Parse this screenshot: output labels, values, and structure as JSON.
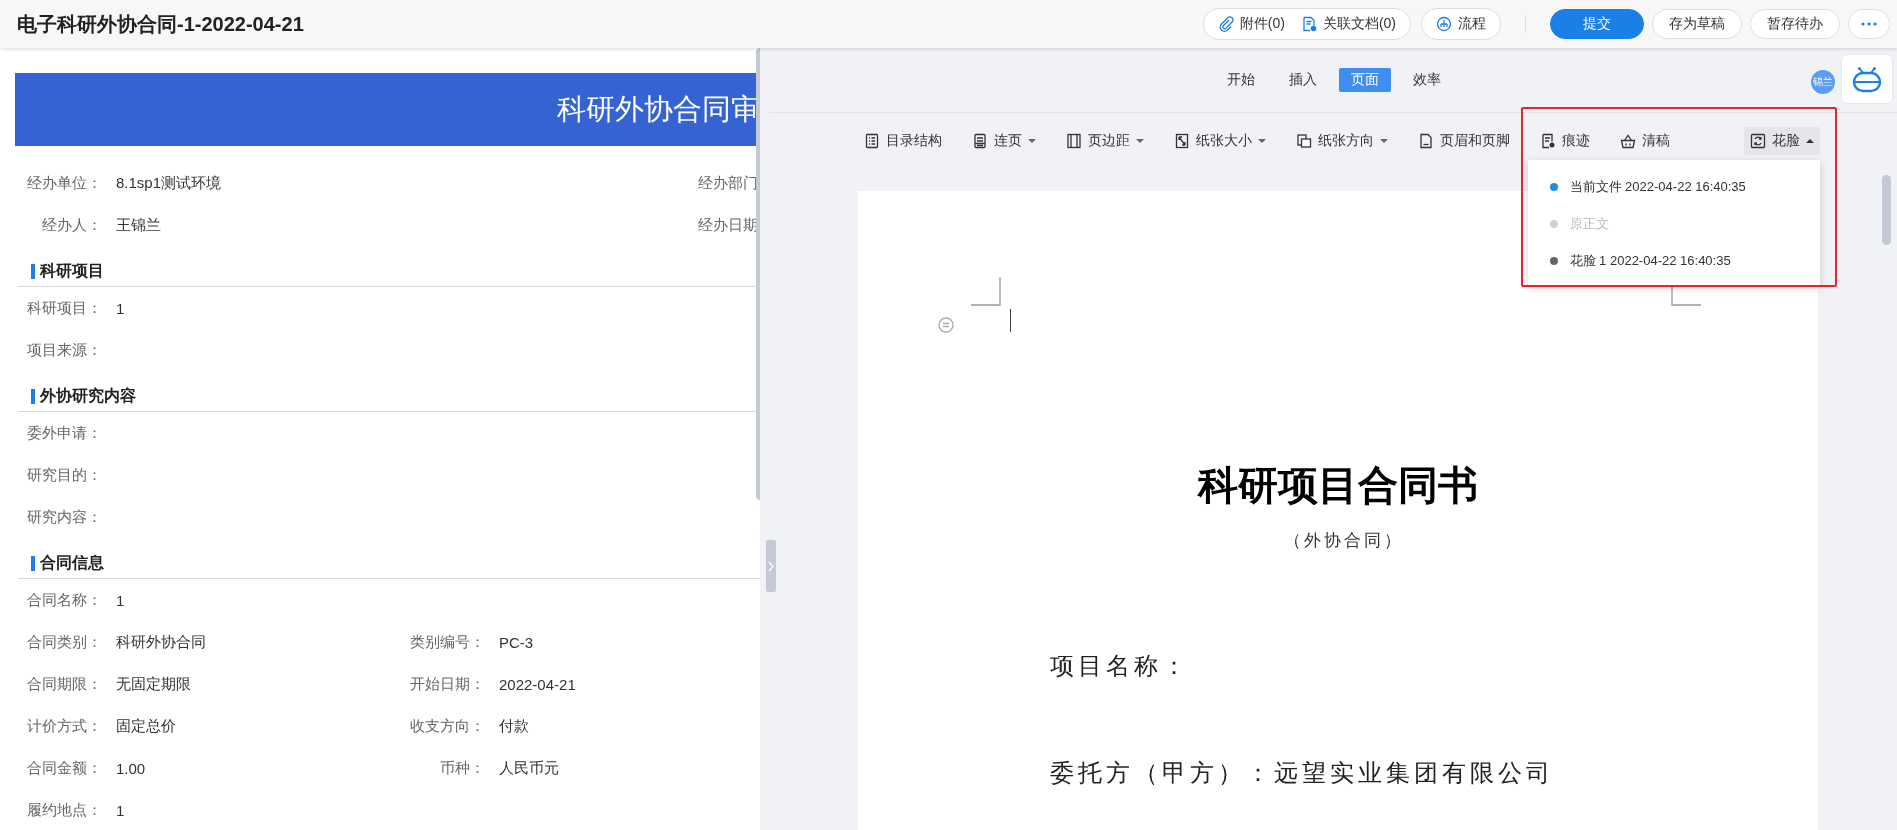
{
  "header": {
    "title": "电子科研外协合同-1-2022-04-21",
    "links": [
      {
        "label": "附件(0)",
        "kind": "attach"
      },
      {
        "label": "关联文档(0)",
        "kind": "linked"
      }
    ],
    "flow_button": "流程",
    "buttons": [
      {
        "label": "提交",
        "primary": true
      },
      {
        "label": "存为草稿",
        "primary": false
      },
      {
        "label": "暂存待办",
        "primary": false
      }
    ]
  },
  "form": {
    "banner": "科研外协合同审",
    "top_rows": [
      {
        "label": "经办单位：",
        "value": "8.1sp1测试环境",
        "right_label": "经办部门"
      },
      {
        "label": "经办人：",
        "value": "王锦兰",
        "right_label": "经办日期"
      }
    ],
    "sections": [
      {
        "title": "科研项目",
        "rows": [
          [
            {
              "label": "科研项目：",
              "value": "1"
            }
          ],
          [
            {
              "label": "项目来源："
            }
          ]
        ]
      },
      {
        "title": "外协研究内容",
        "rows": [
          [
            {
              "label": "委外申请："
            }
          ],
          [
            {
              "label": "研究目的："
            }
          ],
          [
            {
              "label": "研究内容："
            }
          ]
        ]
      },
      {
        "title": "合同信息",
        "rows": [
          [
            {
              "label": "合同名称：",
              "value": "1"
            }
          ],
          [
            {
              "label": "合同类别：",
              "value": "科研外协合同"
            },
            {
              "label": "类别编号：",
              "value": "PC-3"
            }
          ],
          [
            {
              "label": "合同期限：",
              "value": "无固定期限"
            },
            {
              "label": "开始日期：",
              "value": "2022-04-21"
            }
          ],
          [
            {
              "label": "计价方式：",
              "value": "固定总价"
            },
            {
              "label": "收支方向：",
              "value": "付款"
            }
          ],
          [
            {
              "label": "合同金额：",
              "value": "1.00"
            },
            {
              "label": "币种：",
              "value": "人民币元"
            }
          ],
          [
            {
              "label": "履约地点：",
              "value": "1"
            }
          ]
        ]
      }
    ]
  },
  "editor": {
    "tabs": [
      {
        "label": "开始",
        "selected": false
      },
      {
        "label": "插入",
        "selected": false
      },
      {
        "label": "页面",
        "selected": true
      },
      {
        "label": "效率",
        "selected": false
      }
    ],
    "avatar": "锦兰",
    "toolbar": [
      {
        "label": "目录结构",
        "kind": "toc",
        "dropdown": false,
        "expanded": false
      },
      {
        "label": "连页",
        "kind": "page",
        "dropdown": true,
        "expanded": false
      },
      {
        "label": "页边距",
        "kind": "margin",
        "dropdown": true,
        "expanded": false
      },
      {
        "label": "纸张大小",
        "kind": "size",
        "dropdown": true,
        "expanded": false
      },
      {
        "label": "纸张方向",
        "kind": "orient",
        "dropdown": true,
        "expanded": false
      },
      {
        "label": "页眉和页脚",
        "kind": "header",
        "dropdown": false,
        "expanded": false
      },
      {
        "label": "痕迹",
        "kind": "trace",
        "dropdown": false,
        "expanded": false
      },
      {
        "label": "清稿",
        "kind": "clean",
        "dropdown": false,
        "expanded": false
      },
      {
        "label": "花脸",
        "kind": "face",
        "dropdown": true,
        "expanded": true
      }
    ],
    "menu": [
      {
        "label": "当前文件 2022-04-22 16:40:35",
        "color": "#1a8fe3",
        "disabled": false
      },
      {
        "label": "原正文",
        "color": "#d0d0d0",
        "disabled": true
      },
      {
        "label": "花脸 1 2022-04-22 16:40:35",
        "color": "#666666",
        "disabled": false
      }
    ],
    "document": {
      "title": "科研项目合同书",
      "subtitle": "（外协合同）",
      "lines": [
        "项目名称：",
        "委托方（甲方）：远望实业集团有限公司"
      ]
    }
  }
}
